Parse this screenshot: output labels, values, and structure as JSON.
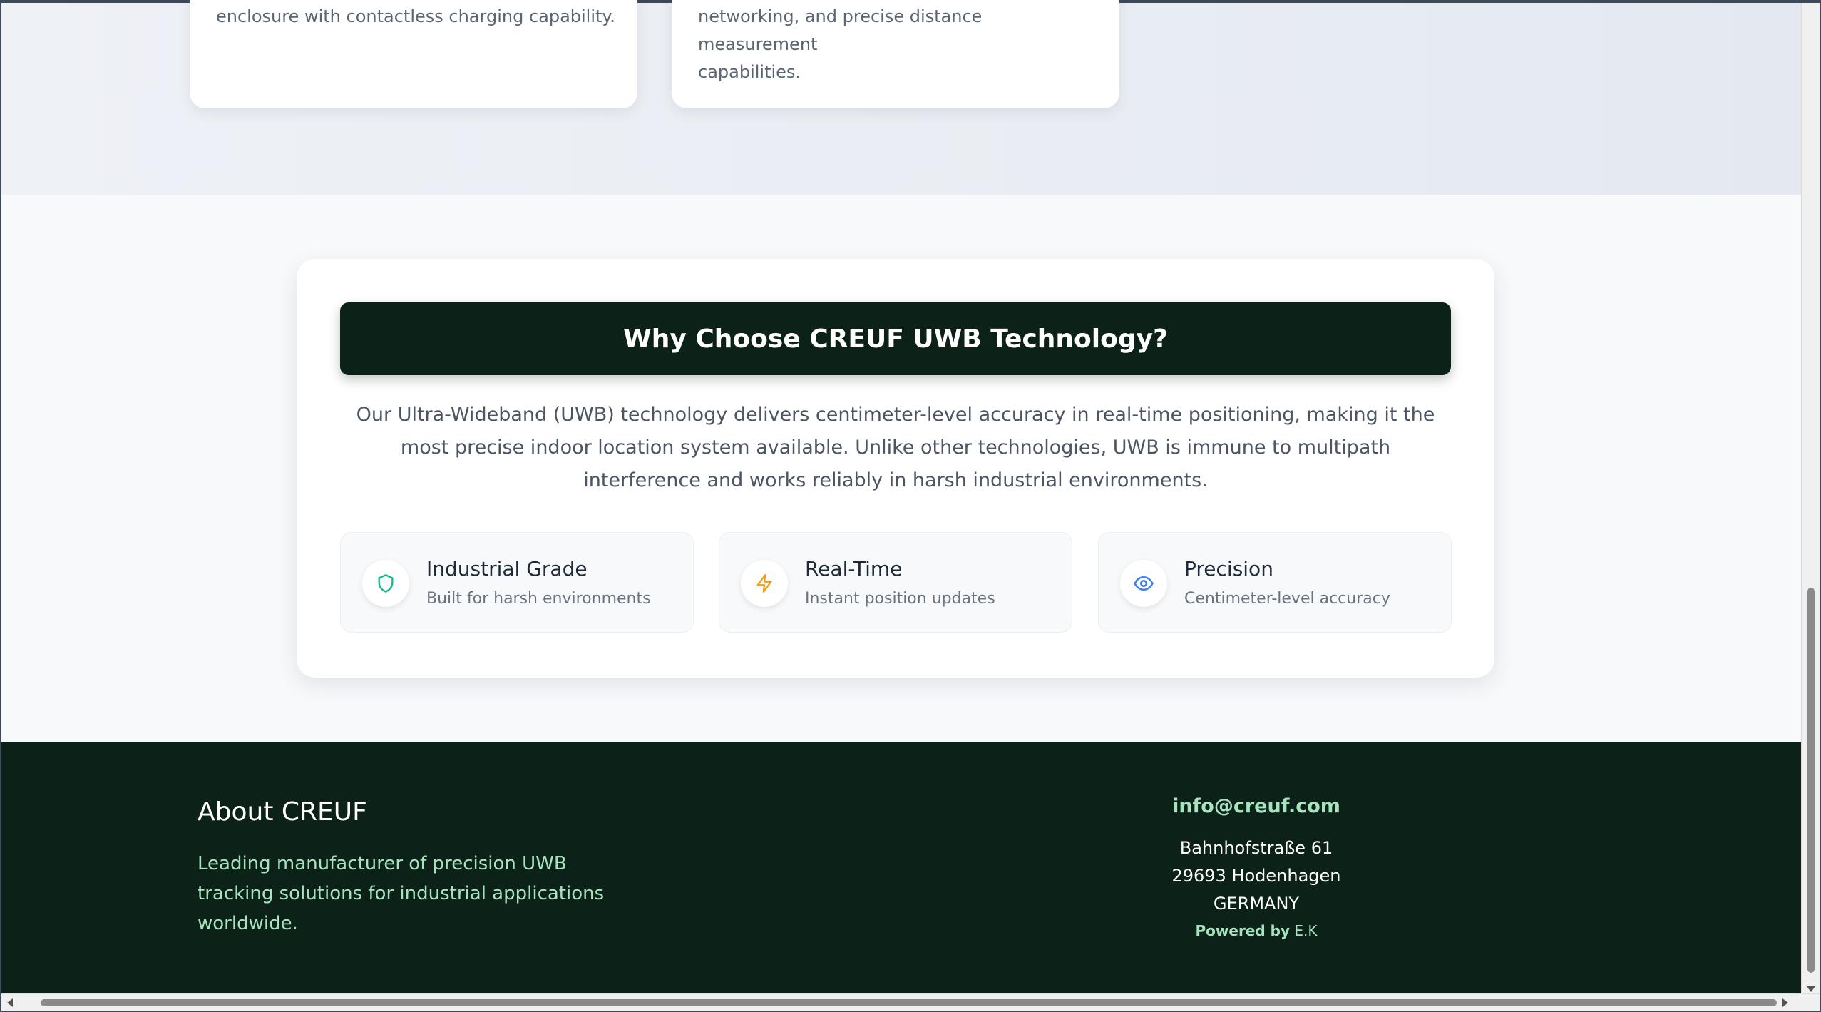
{
  "products": {
    "card1_text": "enclosure with contactless charging capability.",
    "card2_line1": "networking, and precise distance measurement",
    "card2_line2": "capabilities."
  },
  "why": {
    "title": "Why Choose CREUF UWB Technology?",
    "description": "Our Ultra-Wideband (UWB) technology delivers centimeter-level accuracy in real-time positioning, making it the most precise indoor location system available. Unlike other technologies, UWB is immune to multipath interference and works reliably in harsh industrial environments.",
    "features": [
      {
        "title": "Industrial Grade",
        "subtitle": "Built for harsh environments",
        "icon": "shield-icon",
        "color": "#10b981"
      },
      {
        "title": "Real-Time",
        "subtitle": "Instant position updates",
        "icon": "lightning-icon",
        "color": "#f59e0b"
      },
      {
        "title": "Precision",
        "subtitle": "Centimeter-level accuracy",
        "icon": "eye-icon",
        "color": "#3b82f6"
      }
    ]
  },
  "footer": {
    "about_title": "About CREUF",
    "about_text": "Leading manufacturer of precision UWB tracking solutions for industrial applications worldwide.",
    "email": "info@creuf.com",
    "address_line1": "Bahnhofstraße 61",
    "address_line2": "29693 Hodenhagen",
    "address_line3": "GERMANY",
    "powered_prefix": "Powered by",
    "powered_name": "E.K"
  },
  "colors": {
    "dark_green": "#0c2118",
    "mint": "#a7e3bf"
  }
}
